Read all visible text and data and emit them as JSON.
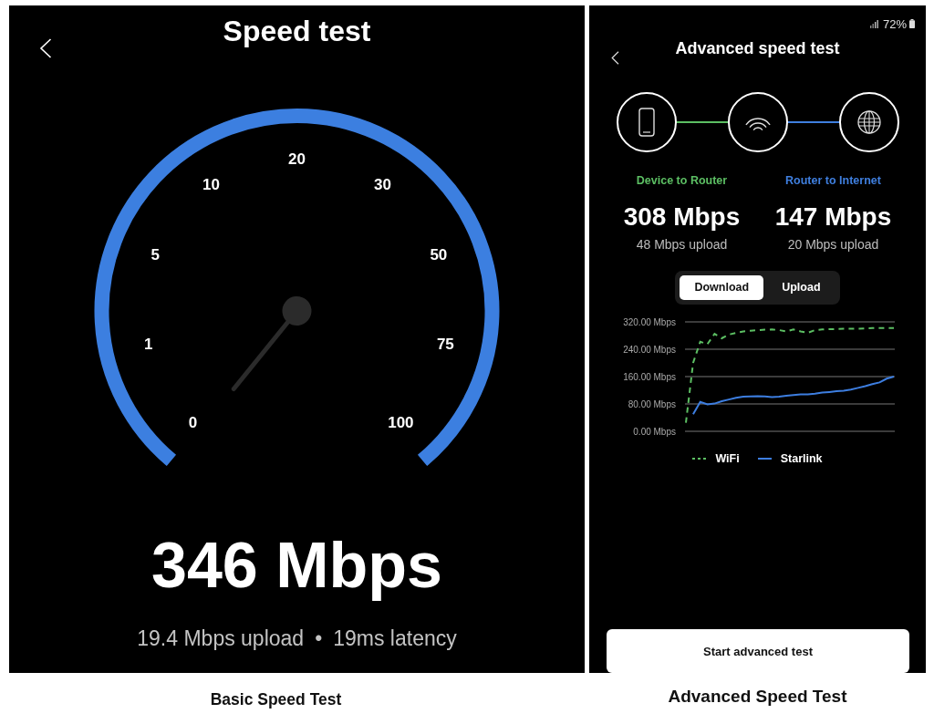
{
  "basic_test": {
    "title": "Speed test",
    "gauge": {
      "ticks": [
        "0",
        "1",
        "5",
        "10",
        "20",
        "30",
        "50",
        "75",
        "100"
      ]
    },
    "speed": "346 Mbps",
    "upload": "19.4 Mbps upload",
    "separator": "•",
    "latency": "19ms latency",
    "caption": "Basic Speed Test"
  },
  "advanced_test": {
    "status_bar": {
      "battery": "72%"
    },
    "title": "Advanced speed test",
    "links": [
      {
        "label": "Device to Router",
        "color": "#5cbf63",
        "download": "308 Mbps",
        "upload": "48 Mbps upload"
      },
      {
        "label": "Router to Internet",
        "color": "#3f7fdf",
        "download": "147 Mbps",
        "upload": "20 Mbps upload"
      }
    ],
    "tabs": [
      {
        "label": "Download",
        "selected": true
      },
      {
        "label": "Upload",
        "selected": false
      }
    ],
    "chart_data": {
      "type": "line",
      "grid": true,
      "ylim": [
        0,
        320
      ],
      "yticks": [
        {
          "value": 0,
          "label": "0.00 Mbps"
        },
        {
          "value": 80,
          "label": "80.00 Mbps"
        },
        {
          "value": 160,
          "label": "160.00 Mbps"
        },
        {
          "value": 240,
          "label": "240.00 Mbps"
        },
        {
          "value": 320,
          "label": "320.00 Mbps"
        }
      ],
      "series": [
        {
          "name": "WiFi",
          "color": "#5cbf63",
          "line_style": "dashed",
          "values": [
            25,
            200,
            262,
            255,
            285,
            272,
            283,
            288,
            292,
            294,
            296,
            297,
            298,
            296,
            292,
            298,
            292,
            288,
            296,
            298,
            299,
            299,
            300,
            300,
            300,
            301,
            302,
            302,
            302,
            302
          ]
        },
        {
          "name": "Starlink",
          "color": "#3d7ee0",
          "line_style": "solid",
          "values": [
            null,
            50,
            86,
            79,
            81,
            88,
            93,
            98,
            101,
            102,
            103,
            102,
            100,
            101,
            104,
            106,
            108,
            108,
            110,
            113,
            115,
            117,
            119,
            122,
            127,
            132,
            138,
            143,
            154,
            160
          ]
        }
      ]
    },
    "button": "Start advanced test",
    "caption": "Advanced Speed Test"
  }
}
